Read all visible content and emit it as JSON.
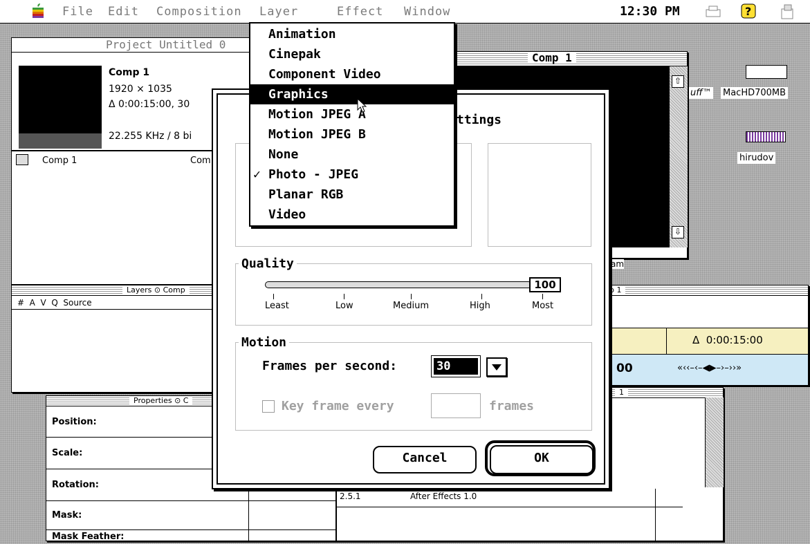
{
  "menubar": {
    "menus": [
      "File",
      "Edit",
      "Composition",
      "Layer",
      "Effect",
      "Window"
    ],
    "clock": "12:30 PM"
  },
  "project_window": {
    "title": "Project Untitled 0",
    "item_name": "Comp 1",
    "item_dims": "1920 × 1035",
    "item_duration": "Δ 0:00:15:00, 30",
    "item_audio": "22.255 KHz / 8 bi",
    "list_item": "Comp 1",
    "list_col": "Com"
  },
  "comp_window": {
    "title": "Comp 1",
    "label_partial": "am"
  },
  "layers_window": {
    "title": "Layers ⊙ Comp",
    "columns": "#  A  V  Q  Source"
  },
  "properties_window": {
    "title": "Properties ⊙ C",
    "rows": [
      "Position:",
      "Scale:",
      "Rotation:",
      "Mask:",
      "Mask Feather:"
    ]
  },
  "time_window": {
    "title_partial": "p 1",
    "duration": "Δ  0:00:15:00",
    "time_partial": "00",
    "nav": "«‹‹–‹–◀▶–›–››»"
  },
  "info_window": {
    "title_partial": "1",
    "version_partial": "2.5.1",
    "app_name": "After Effects 1.0"
  },
  "desktop": {
    "drive_label": "MacHD700MB",
    "stuff_label": "uff™",
    "file_label": "hirudov"
  },
  "menu": {
    "items": [
      {
        "label": "Animation",
        "checked": false,
        "selected": false
      },
      {
        "label": "Cinepak",
        "checked": false,
        "selected": false
      },
      {
        "label": "Component Video",
        "checked": false,
        "selected": false
      },
      {
        "label": "Graphics",
        "checked": false,
        "selected": true
      },
      {
        "label": "Motion JPEG A",
        "checked": false,
        "selected": false
      },
      {
        "label": "Motion JPEG B",
        "checked": false,
        "selected": false
      },
      {
        "label": "None",
        "checked": false,
        "selected": false
      },
      {
        "label": "Photo - JPEG",
        "checked": true,
        "selected": false
      },
      {
        "label": "Planar RGB",
        "checked": false,
        "selected": false
      },
      {
        "label": "Video",
        "checked": false,
        "selected": false
      }
    ],
    "check_glyph": "✓"
  },
  "dialog": {
    "title_partial": "ttings",
    "quality": {
      "label": "Quality",
      "value": "100",
      "level": 1.0,
      "ticks": [
        "Least",
        "Low",
        "Medium",
        "High",
        "Most"
      ]
    },
    "motion": {
      "label": "Motion",
      "fps_label": "Frames per second:",
      "fps_value": "30",
      "keyframe_label": "Key frame every",
      "keyframe_value": "",
      "keyframe_unit": "frames"
    },
    "cancel_label": "Cancel",
    "ok_label": "OK"
  }
}
